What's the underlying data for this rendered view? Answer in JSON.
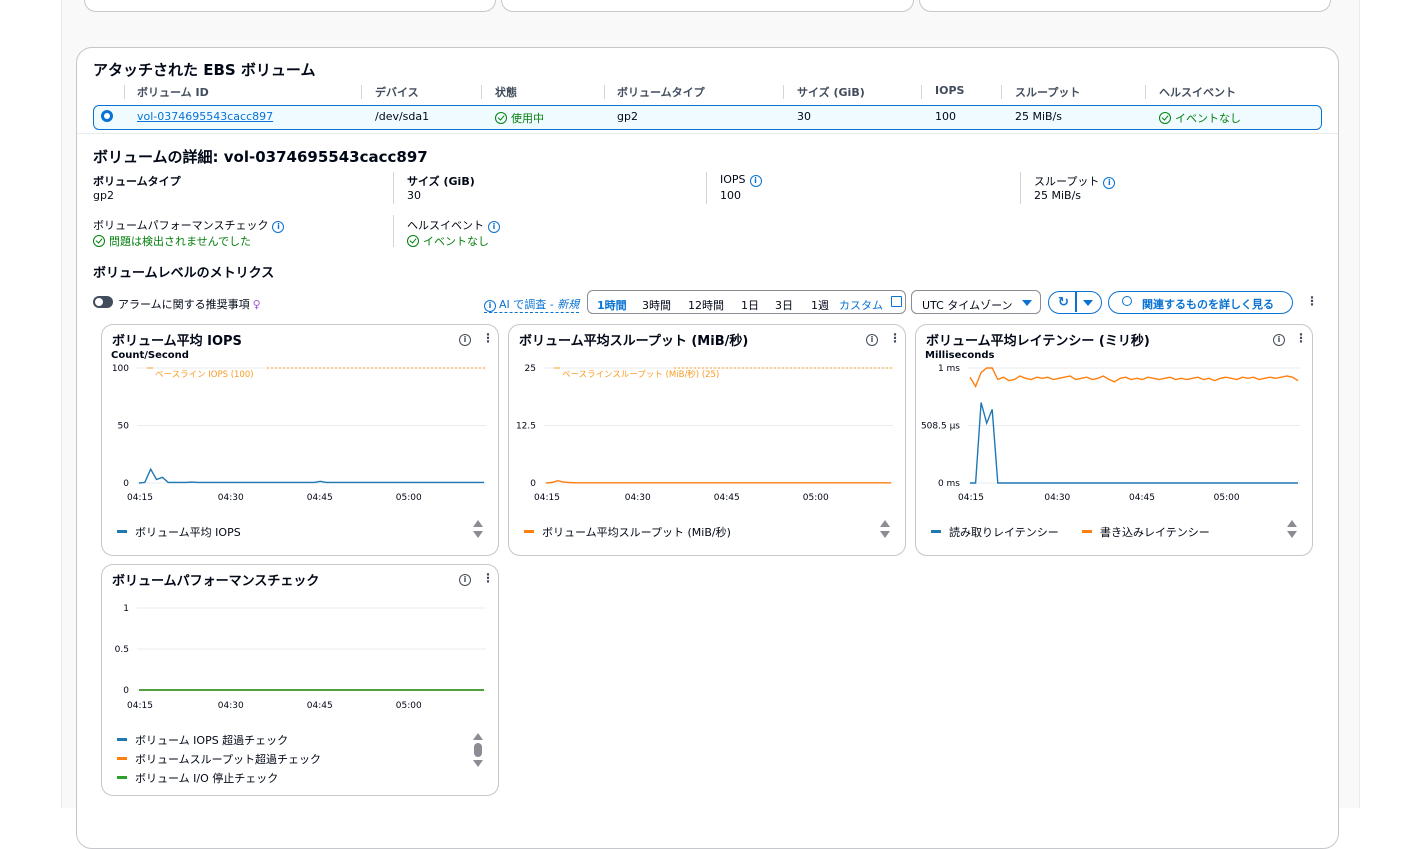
{
  "section_title": "アタッチされた EBS ボリューム",
  "table": {
    "headers": [
      "ボリューム ID",
      "デバイス",
      "状態",
      "ボリュームタイプ",
      "サイズ (GiB)",
      "IOPS",
      "スループット",
      "ヘルスイベント"
    ],
    "row": {
      "volume_id": "vol-0374695543cacc897",
      "device": "/dev/sda1",
      "state": "使用中",
      "volume_type": "gp2",
      "size": "30",
      "iops": "100",
      "throughput": "25 MiB/s",
      "health": "イベントなし"
    }
  },
  "details": {
    "title": "ボリュームの詳細: vol-0374695543cacc897",
    "type_label": "ボリュームタイプ",
    "type_value": "gp2",
    "size_label": "サイズ (GiB)",
    "size_value": "30",
    "iops_label": "IOPS",
    "iops_value": "100",
    "throughput_label": "スループット",
    "throughput_value": "25 MiB/s",
    "perf_label": "ボリュームパフォーマンスチェック",
    "perf_value": "問題は検出されませんでした",
    "health_label": "ヘルスイベント",
    "health_value": "イベントなし"
  },
  "metrics": {
    "title": "ボリュームレベルのメトリクス",
    "alarm_toggle": "アラームに関する推奨事項",
    "ai_link": "AI で調査 - ",
    "ai_new": "新規",
    "time_ranges": [
      "1時間",
      "3時間",
      "12時間",
      "1日",
      "3日",
      "1週"
    ],
    "custom": "カスタム",
    "timezone": "UTC タイムゾーン",
    "explore_button": "関連するものを詳しく見る"
  },
  "colors": {
    "blue": "#1f77b4",
    "orange": "#ff7f0e",
    "green": "#2ca02c",
    "baseline": "#f89c24"
  },
  "chart_data": [
    {
      "type": "line",
      "title": "ボリューム平均 IOPS",
      "unit_label": "Count/Second",
      "yticks": [
        "100",
        "50",
        "0"
      ],
      "ylim": [
        0,
        100
      ],
      "xticks": [
        "04:15",
        "04:30",
        "04:45",
        "05:00"
      ],
      "baseline": {
        "label": "ベースライン IOPS (100)",
        "value": 100
      },
      "series": [
        {
          "name": "ボリューム平均 IOPS",
          "color": "#1f77b4",
          "values": [
            0,
            0.5,
            12,
            3,
            5,
            0.5,
            0.5,
            0.5,
            0.5,
            0.8,
            0.5,
            0.5,
            0.5,
            0.5,
            0.5,
            0.5,
            0.5,
            0.5,
            0.5,
            0.5,
            0.5,
            0.5,
            0.5,
            0.5,
            0.5,
            0.5,
            0.5,
            0.5,
            0.5,
            0.5,
            0.5,
            1.5,
            0.5,
            0.5,
            0.5,
            0.5,
            0.5,
            0.5,
            0.5,
            0.5,
            0.5,
            0.5,
            0.5,
            0.5,
            0.5,
            0.5,
            0.5,
            0.5,
            0.5,
            0.5,
            0.5,
            0.5,
            0.5,
            0.5,
            0.5,
            0.5,
            0.5,
            0.5,
            0.5,
            0.5
          ]
        }
      ]
    },
    {
      "type": "line",
      "title": "ボリューム平均スループット (MiB/秒)",
      "unit_label": "",
      "yticks": [
        "25",
        "12.5",
        "0"
      ],
      "ylim": [
        0,
        25
      ],
      "xticks": [
        "04:15",
        "04:30",
        "04:45",
        "05:00"
      ],
      "baseline": {
        "label": "ベースラインスループット (MiB/秒) (25)",
        "value": 25
      },
      "series": [
        {
          "name": "ボリューム平均スループット (MiB/秒)",
          "color": "#ff7f0e",
          "values": [
            0,
            0.1,
            0.5,
            0.2,
            0.1,
            0.05,
            0.05,
            0.05,
            0.05,
            0.05,
            0.05,
            0.05,
            0.05,
            0.05,
            0.05,
            0.05,
            0.05,
            0.05,
            0.05,
            0.05,
            0.05,
            0.05,
            0.05,
            0.05,
            0.05,
            0.05,
            0.05,
            0.05,
            0.05,
            0.05,
            0.05,
            0.05,
            0.05,
            0.05,
            0.05,
            0.05,
            0.05,
            0.05,
            0.05,
            0.05,
            0.05,
            0.05,
            0.05,
            0.05,
            0.05,
            0.05,
            0.05,
            0.05,
            0.05,
            0.05,
            0.05,
            0.05,
            0.05,
            0.05,
            0.05,
            0.05,
            0.05,
            0.05,
            0.05,
            0.05
          ]
        }
      ]
    },
    {
      "type": "line",
      "title": "ボリューム平均レイテンシー (ミリ秒)",
      "unit_label": "Milliseconds",
      "yticks": [
        "1 ms",
        "508.5 μs",
        "0 ms"
      ],
      "ylim": [
        0,
        1
      ],
      "xticks": [
        "04:15",
        "04:30",
        "04:45",
        "05:00"
      ],
      "series": [
        {
          "name": "読み取りレイテンシー",
          "color": "#1f77b4",
          "values": [
            0,
            0,
            0.7,
            0.52,
            0.64,
            0,
            0,
            0,
            0,
            0,
            0,
            0,
            0,
            0,
            0,
            0,
            0,
            0,
            0,
            0,
            0,
            0,
            0,
            0,
            0,
            0,
            0,
            0,
            0,
            0,
            0,
            0,
            0,
            0,
            0,
            0,
            0,
            0,
            0,
            0,
            0,
            0,
            0,
            0,
            0,
            0,
            0,
            0,
            0,
            0,
            0,
            0,
            0,
            0,
            0,
            0,
            0,
            0,
            0,
            0
          ]
        },
        {
          "name": "書き込みレイテンシー",
          "color": "#ff7f0e",
          "values": [
            0.92,
            0.84,
            0.96,
            1.0,
            1.0,
            0.9,
            0.92,
            0.89,
            0.9,
            0.93,
            0.91,
            0.9,
            0.92,
            0.91,
            0.92,
            0.9,
            0.91,
            0.92,
            0.93,
            0.9,
            0.91,
            0.92,
            0.9,
            0.91,
            0.93,
            0.9,
            0.88,
            0.91,
            0.92,
            0.9,
            0.91,
            0.9,
            0.92,
            0.91,
            0.9,
            0.91,
            0.92,
            0.9,
            0.91,
            0.9,
            0.91,
            0.92,
            0.9,
            0.91,
            0.89,
            0.91,
            0.92,
            0.91,
            0.9,
            0.92,
            0.91,
            0.92,
            0.9,
            0.91,
            0.92,
            0.91,
            0.92,
            0.93,
            0.92,
            0.89
          ]
        }
      ]
    },
    {
      "type": "line",
      "title": "ボリュームパフォーマンスチェック",
      "unit_label": "",
      "yticks": [
        "1",
        "0.5",
        "0"
      ],
      "ylim": [
        0,
        1
      ],
      "xticks": [
        "04:15",
        "04:30",
        "04:45",
        "05:00"
      ],
      "series": [
        {
          "name": "ボリューム IOPS 超過チェック",
          "color": "#1f77b4",
          "values": [
            0,
            0,
            0,
            0,
            0,
            0,
            0,
            0,
            0,
            0,
            0,
            0,
            0,
            0,
            0,
            0,
            0,
            0,
            0,
            0,
            0,
            0,
            0,
            0,
            0,
            0,
            0,
            0,
            0,
            0,
            0,
            0,
            0,
            0,
            0,
            0,
            0,
            0,
            0,
            0,
            0,
            0,
            0,
            0,
            0,
            0,
            0,
            0,
            0,
            0,
            0,
            0,
            0,
            0,
            0,
            0,
            0,
            0,
            0,
            0
          ]
        },
        {
          "name": "ボリュームスループット超過チェック",
          "color": "#ff7f0e",
          "values": [
            0,
            0,
            0,
            0,
            0,
            0,
            0,
            0,
            0,
            0,
            0,
            0,
            0,
            0,
            0,
            0,
            0,
            0,
            0,
            0,
            0,
            0,
            0,
            0,
            0,
            0,
            0,
            0,
            0,
            0,
            0,
            0,
            0,
            0,
            0,
            0,
            0,
            0,
            0,
            0,
            0,
            0,
            0,
            0,
            0,
            0,
            0,
            0,
            0,
            0,
            0,
            0,
            0,
            0,
            0,
            0,
            0,
            0,
            0,
            0
          ]
        },
        {
          "name": "ボリューム I/O 停止チェック",
          "color": "#2ca02c",
          "values": [
            0,
            0,
            0,
            0,
            0,
            0,
            0,
            0,
            0,
            0,
            0,
            0,
            0,
            0,
            0,
            0,
            0,
            0,
            0,
            0,
            0,
            0,
            0,
            0,
            0,
            0,
            0,
            0,
            0,
            0,
            0,
            0,
            0,
            0,
            0,
            0,
            0,
            0,
            0,
            0,
            0,
            0,
            0,
            0,
            0,
            0,
            0,
            0,
            0,
            0,
            0,
            0,
            0,
            0,
            0,
            0,
            0,
            0,
            0,
            0
          ]
        }
      ]
    }
  ]
}
